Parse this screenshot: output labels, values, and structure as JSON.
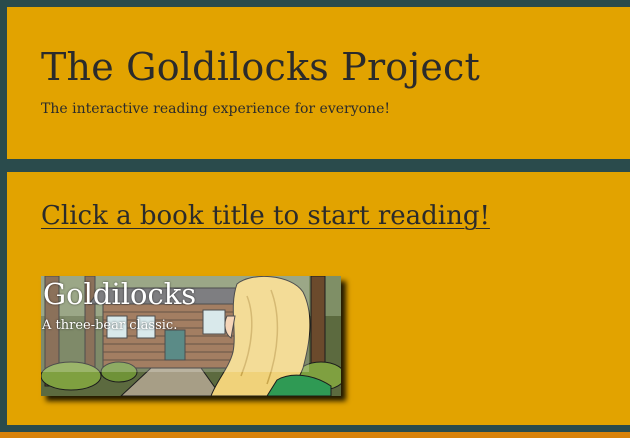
{
  "header": {
    "title": "The Goldilocks Project",
    "subtitle": "The interactive reading experience for everyone!"
  },
  "main": {
    "cta": "Click a book title to start reading!",
    "books": [
      {
        "title": "Goldilocks",
        "description": "A three-bear classic.",
        "cover_icon": "cabin-girl-illustration"
      }
    ]
  },
  "colors": {
    "panel_background": "#e2a300",
    "panel_border": "#2a4b4c",
    "page_background": "#d8820a",
    "text": "#2b2b2b"
  }
}
